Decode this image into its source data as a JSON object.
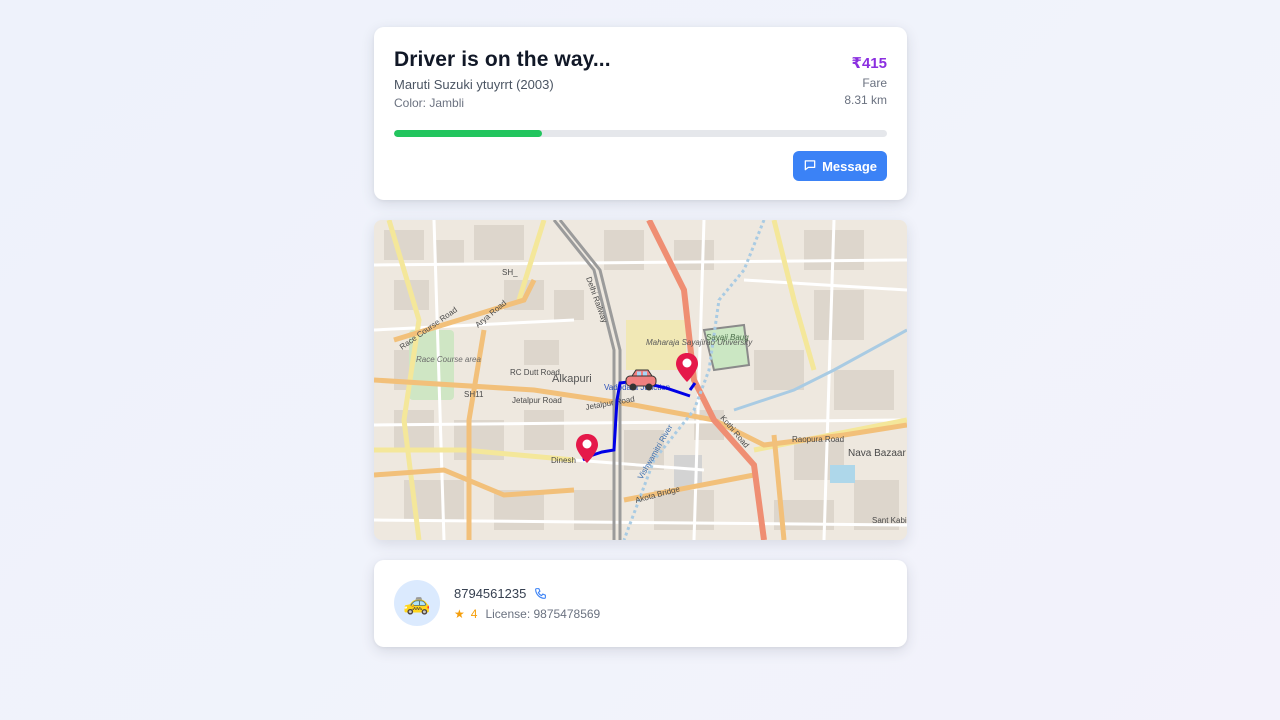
{
  "status": {
    "title": "Driver is on the way...",
    "car_model": "Maruti Suzuki ytuyrrt (2003)",
    "car_color": "Color: Jambli",
    "fare_amount": "₹415",
    "fare_label": "Fare",
    "distance": "8.31 km",
    "progress": 0.3,
    "message_label": "Message",
    "progress_color": "#22c55e",
    "button_color": "#3b82f6",
    "fare_color": "#8b2fe0"
  },
  "map": {
    "labels": {
      "sh_top": "SH_",
      "race_course_road": "Race Course Road",
      "race_course_area": "Race Course area",
      "rc_dutt": "RC Dutt Road",
      "alkapuri": "Alkapuri",
      "sh11": "SH11",
      "jetalpur_road": "Jetalpur Road",
      "jetalpur_road2": "Jetalpur Road",
      "maharaja": "Maharaja Sayajirao University",
      "sayaji_baug": "Sayaji Baug",
      "vadodara": "Vadodara Junction",
      "kothi_road": "Kothi Road",
      "raopura_road": "Raopura Road",
      "nava_bazar": "Nava Bazaar",
      "vishwamitri": "Vishwamitri River",
      "akota_bridge": "Akota Bridge",
      "dinesh": "Dinesh",
      "sant_kabir": "Sant Kabir",
      "delhi_railway": "Delhi Railway",
      "arya_road": "Arya Road"
    },
    "icons": [
      "car-icon",
      "pickup-pin-icon",
      "dropoff-pin-icon"
    ],
    "route_color": "#0000e6"
  },
  "driver": {
    "avatar_icon": "taxi-icon",
    "phone": "8794561235",
    "rating": "4",
    "license": "License: 9875478569"
  }
}
